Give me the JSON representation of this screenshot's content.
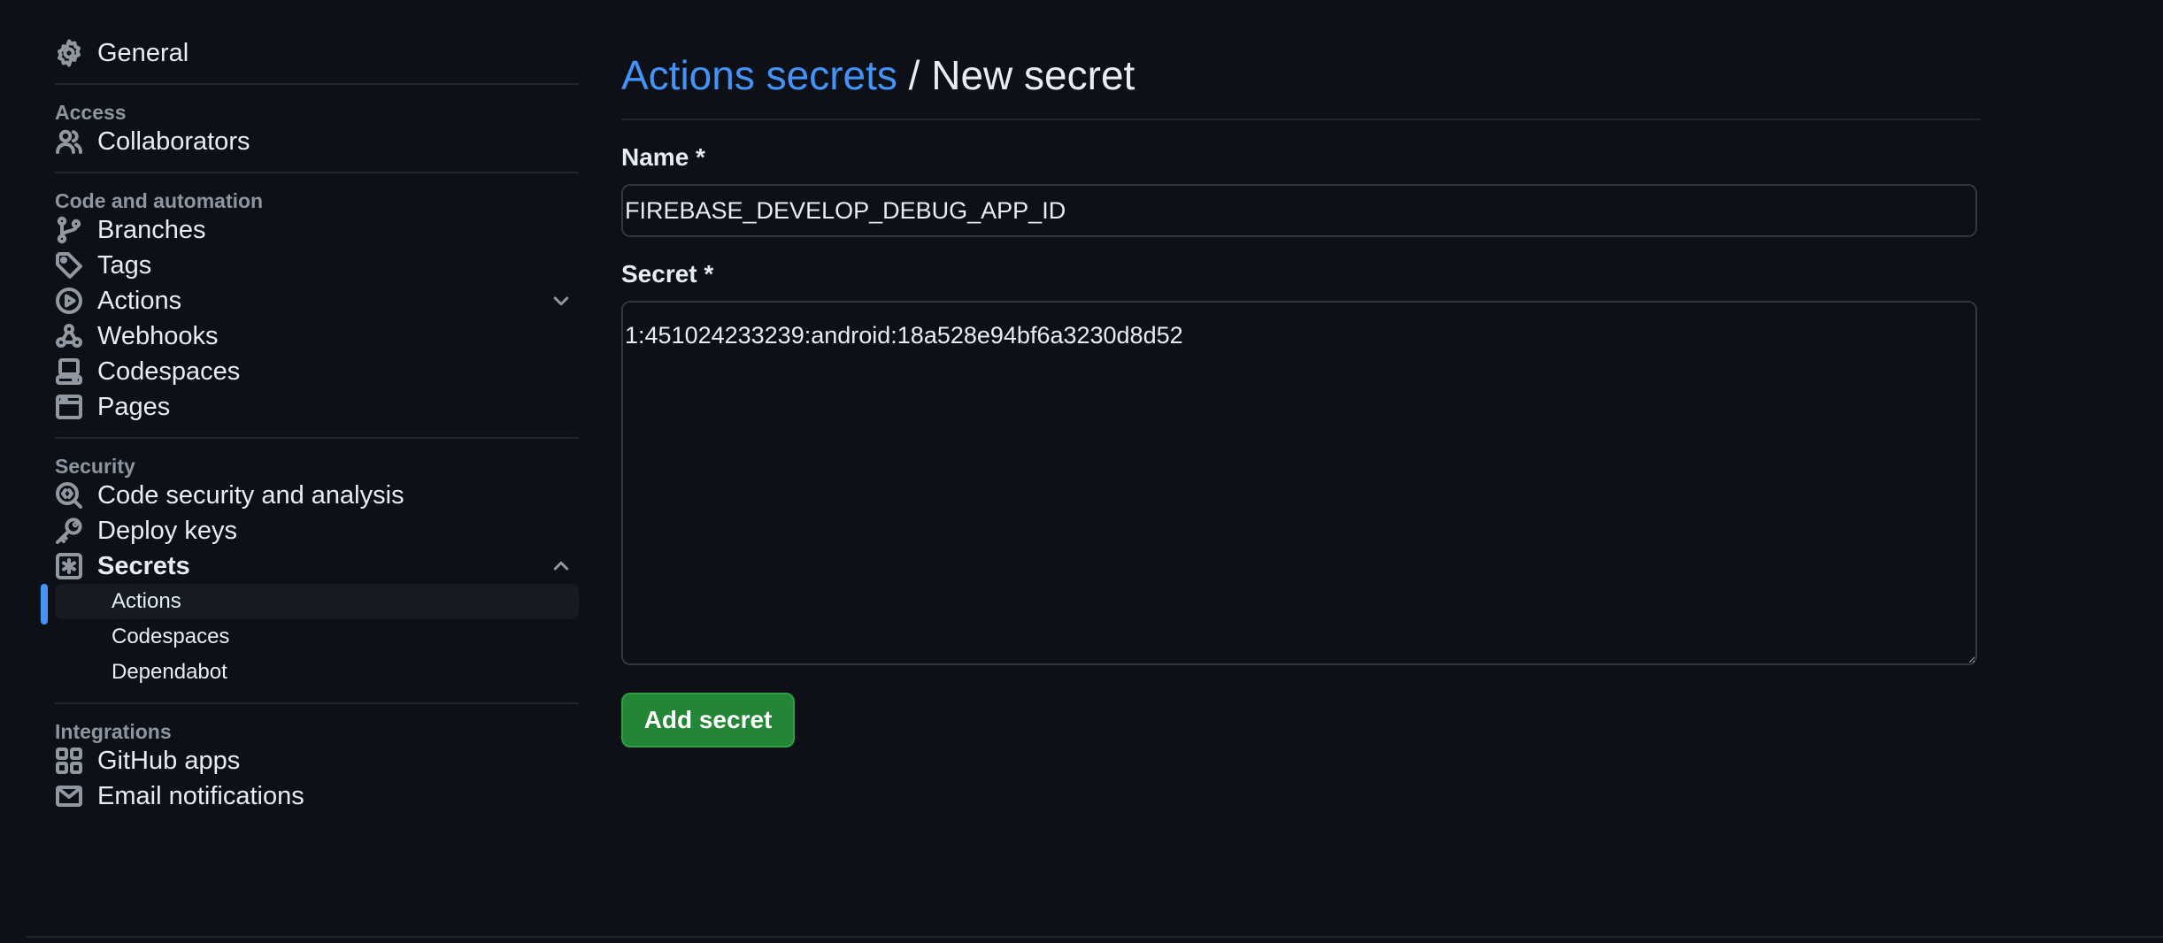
{
  "sidebar": {
    "general": {
      "label": "General",
      "icon": "gear-icon"
    },
    "groups": {
      "access": {
        "label": "Access",
        "items": [
          {
            "label": "Collaborators",
            "icon": "people-icon"
          }
        ]
      },
      "code": {
        "label": "Code and automation",
        "items": [
          {
            "label": "Branches",
            "icon": "git-branch-icon"
          },
          {
            "label": "Tags",
            "icon": "tag-icon"
          },
          {
            "label": "Actions",
            "icon": "play-icon"
          },
          {
            "label": "Webhooks",
            "icon": "webhook-icon"
          },
          {
            "label": "Codespaces",
            "icon": "codespaces-icon"
          },
          {
            "label": "Pages",
            "icon": "browser-icon"
          }
        ]
      },
      "security": {
        "label": "Security",
        "items": [
          {
            "label": "Code security and analysis",
            "icon": "codescan-icon"
          },
          {
            "label": "Deploy keys",
            "icon": "key-icon"
          },
          {
            "label": "Secrets",
            "icon": "asterisk-icon"
          }
        ],
        "secrets_sub": [
          {
            "label": "Actions",
            "active": true
          },
          {
            "label": "Codespaces",
            "active": false
          },
          {
            "label": "Dependabot",
            "active": false
          }
        ]
      },
      "integrations": {
        "label": "Integrations",
        "items": [
          {
            "label": "GitHub apps",
            "icon": "apps-icon"
          },
          {
            "label": "Email notifications",
            "icon": "mail-icon"
          }
        ]
      }
    }
  },
  "main": {
    "breadcrumb_link": "Actions secrets",
    "breadcrumb_sep": " / ",
    "breadcrumb_current": "New secret",
    "name_label": "Name *",
    "name_value": "FIREBASE_DEVELOP_DEBUG_APP_ID",
    "secret_label": "Secret *",
    "secret_value": "1:451024233239:android:18a528e94bf6a3230d8d52",
    "submit_label": "Add secret"
  },
  "colors": {
    "background": "#0d1117",
    "link": "#4493f8",
    "button": "#238636",
    "muted": "#8d96a0"
  }
}
